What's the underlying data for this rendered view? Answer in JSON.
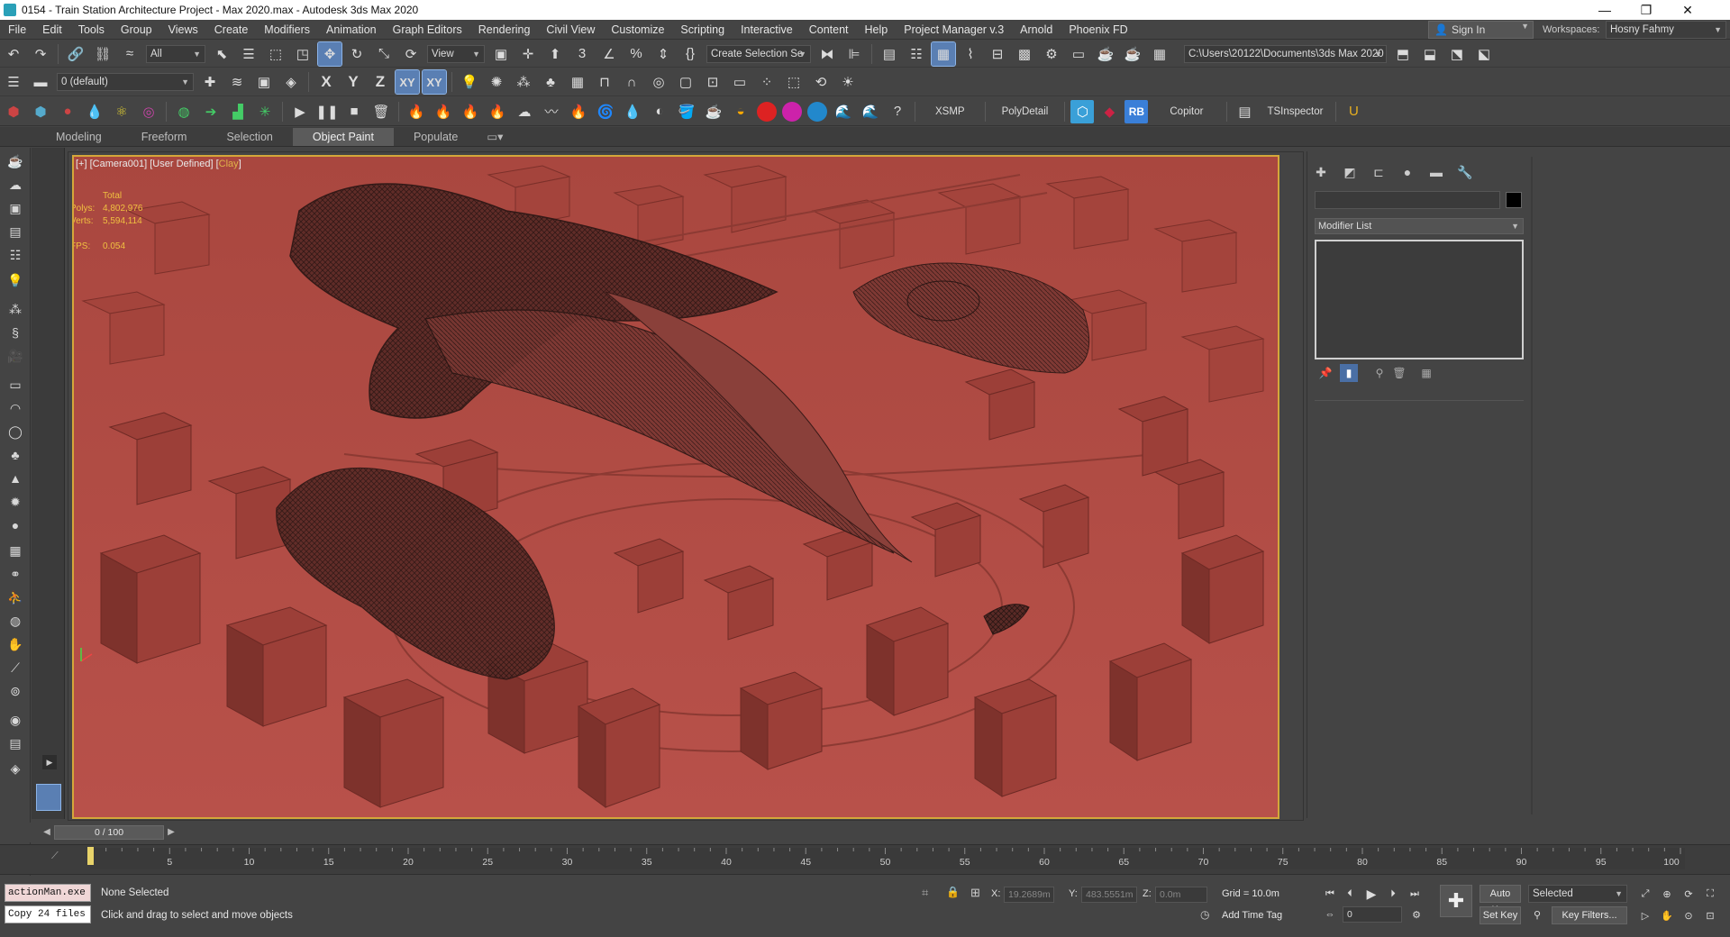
{
  "window": {
    "title": "0154 - Train Station Architecture Project - Max 2020.max - Autodesk 3ds Max 2020",
    "min": "—",
    "max": "❐",
    "close": "✕"
  },
  "menu": [
    "File",
    "Edit",
    "Tools",
    "Group",
    "Views",
    "Create",
    "Modifiers",
    "Animation",
    "Graph Editors",
    "Rendering",
    "Civil View",
    "Customize",
    "Scripting",
    "Interactive",
    "Content",
    "Help",
    "Project Manager v.3",
    "Arnold",
    "Phoenix FD"
  ],
  "account": {
    "sign_in": "Sign In",
    "workspaces_label": "Workspaces:",
    "workspace": "Hosny Fahmy"
  },
  "toolbar1": {
    "selection_filter": "All",
    "ref_coord": "View",
    "selection_set": "Create Selection Se",
    "project_path": "C:\\Users\\20122\\Documents\\3ds Max 2020"
  },
  "toolbar2": {
    "layer": "0 (default)",
    "axis_x": "X",
    "axis_y": "Y",
    "axis_z": "Z",
    "axis_xy": "XY",
    "axis_xy2": "XY"
  },
  "toolbar3": {
    "xsmp": "XSMP",
    "polydetail": "PolyDetail",
    "rb": "RB",
    "copitor": "Copitor",
    "tsinspector": "TSInspector"
  },
  "ribbon_tabs": [
    "Modeling",
    "Freeform",
    "Selection",
    "Object Paint",
    "Populate"
  ],
  "ribbon_active": "Object Paint",
  "viewport": {
    "label_prefix": "[+] [Camera001] [User Defined] [",
    "label_mode": "Clay",
    "label_suffix": "]",
    "stats_total": "Total",
    "polys_label": "Polys:",
    "polys_value": "4,802,976",
    "verts_label": "Verts:",
    "verts_value": "5,594,114",
    "fps_label": "FPS:",
    "fps_value": "0.054"
  },
  "command_panel": {
    "modifier_list": "Modifier List"
  },
  "time_slider": {
    "frame": "0 / 100",
    "current_fraction": 0.0
  },
  "track_bar": {
    "ticks": [
      "5",
      "10",
      "15",
      "20",
      "25",
      "30",
      "35",
      "40",
      "45",
      "50",
      "55",
      "60",
      "65",
      "70",
      "75",
      "80",
      "85",
      "90",
      "95",
      "100"
    ],
    "start": 0,
    "end": 100
  },
  "status": {
    "maxscript_top": "actionMan.exe",
    "maxscript_bottom": "Copy 24 files",
    "selection": "None Selected",
    "prompt": "Click and drag to select and move objects",
    "x_label": "X:",
    "x_value": "19.2689m",
    "y_label": "Y:",
    "y_value": "483.5551m",
    "z_label": "Z:",
    "z_value": "0.0m",
    "grid": "Grid = 10.0m",
    "add_time_tag": "Add Time Tag",
    "auto_key": "Auto Key",
    "set_key": "Set Key",
    "key_mode": "Selected",
    "key_filters": "Key Filters...",
    "frame_field": "0"
  },
  "colors": {
    "viewport_clay": "#b24d44",
    "accent": "#5a7fb3",
    "viewport_border": "#d4a73a",
    "stats": "#f0c040"
  }
}
